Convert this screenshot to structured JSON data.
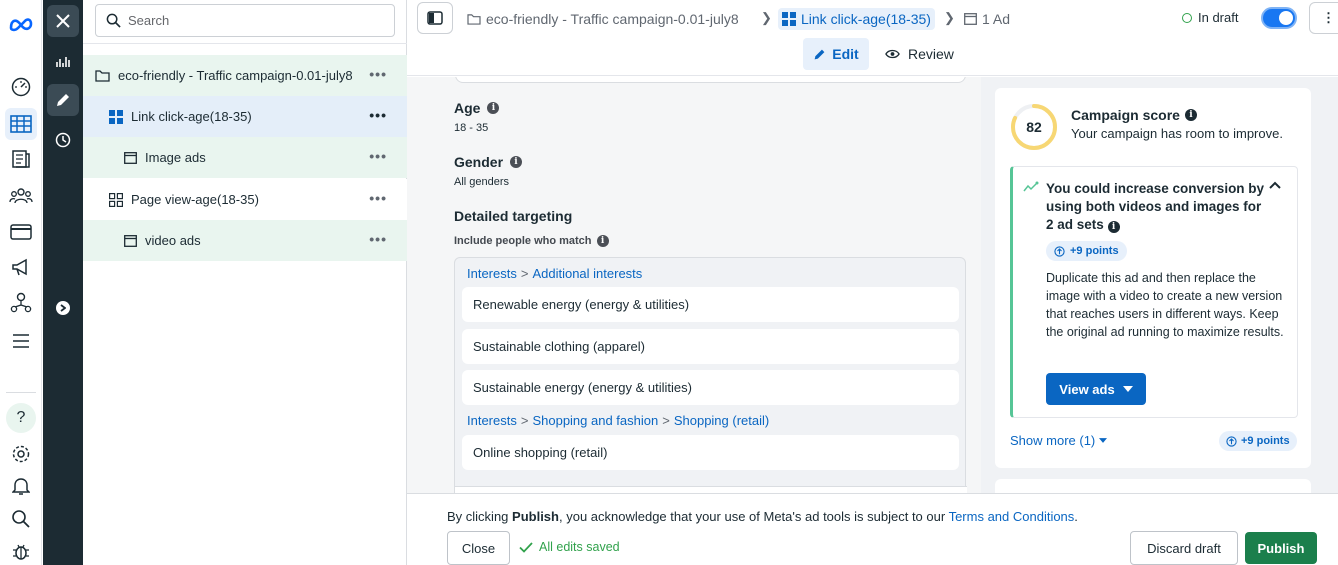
{
  "rail": {
    "icons": [
      "meta-logo-icon",
      "dashboard-icon",
      "campaigns-table-icon",
      "pages-icon",
      "audiences-icon",
      "billing-icon",
      "ads-megaphone-icon",
      "accounts-icon",
      "menu-icon",
      "help-icon",
      "settings-icon",
      "notifications-icon",
      "search-icon",
      "bug-icon"
    ]
  },
  "dark_bar": {
    "icons": [
      "close-icon",
      "chart-icon",
      "edit-pencil-icon",
      "history-clock-icon",
      "expand-arrow-icon"
    ]
  },
  "tree": {
    "search_placeholder": "Search",
    "items": [
      {
        "label": "eco-friendly - Traffic campaign-0.01-july8",
        "icon": "folder-icon",
        "more": "•••"
      },
      {
        "label": "Link click-age(18-35)",
        "icon": "adset-grid-icon",
        "more": "•••"
      },
      {
        "label": "Image ads",
        "icon": "ad-window-icon",
        "more": "•••"
      },
      {
        "label": "Page view-age(18-35)",
        "icon": "adset-grid-icon",
        "more": "•••"
      },
      {
        "label": "video ads",
        "icon": "ad-window-icon",
        "more": "•••"
      }
    ]
  },
  "topbar": {
    "breadcrumb": [
      {
        "label": "eco-friendly - Traffic campaign-0.01-july8"
      },
      {
        "label": "Link click-age(18-35)"
      },
      {
        "label": "1 Ad"
      }
    ],
    "status": "In draft",
    "tabs": {
      "edit": "Edit",
      "review": "Review"
    },
    "more": "⋮"
  },
  "form": {
    "age_label": "Age",
    "age_value": "18 - 35",
    "gender_label": "Gender",
    "gender_value": "All genders",
    "detailed_label": "Detailed targeting",
    "include_label": "Include people who match",
    "groups": [
      {
        "path": [
          "Interests",
          "Additional interests"
        ],
        "items": [
          "Renewable energy (energy & utilities)",
          "Sustainable clothing (apparel)",
          "Sustainable energy (energy & utilities)"
        ]
      },
      {
        "path": [
          "Interests",
          "Shopping and fashion",
          "Shopping (retail)"
        ],
        "items": [
          "Online shopping (retail)"
        ]
      }
    ]
  },
  "score": {
    "value": "82",
    "score_fraction": 0.82,
    "title": "Campaign score",
    "subtitle": "Your campaign has room to improve.",
    "tip_title": "You could increase conversion by using both videos and images for 2 ad sets",
    "tip_points": "+9 points",
    "tip_body": "Duplicate this ad and then replace the image with a video to create a new version that reaches users in different ways. Keep the original ad running to maximize results.",
    "view_ads": "View ads",
    "show_more": "Show more (1)",
    "points_small": "+9 points"
  },
  "footer": {
    "legal_prefix": "By clicking ",
    "legal_bold": "Publish",
    "legal_middle": ", you acknowledge that your use of Meta's ad tools is subject to our ",
    "legal_link": "Terms and Conditions",
    "legal_suffix": ".",
    "close": "Close",
    "saved": "All edits saved",
    "discard": "Discard draft",
    "publish": "Publish"
  },
  "colors": {
    "accent": "#0a66c2",
    "publish_green": "#1b7f4c",
    "tree_green_bg": "#e9f5ef",
    "dark_bar": "#1c2b33",
    "score_ring": "#f7d774"
  }
}
